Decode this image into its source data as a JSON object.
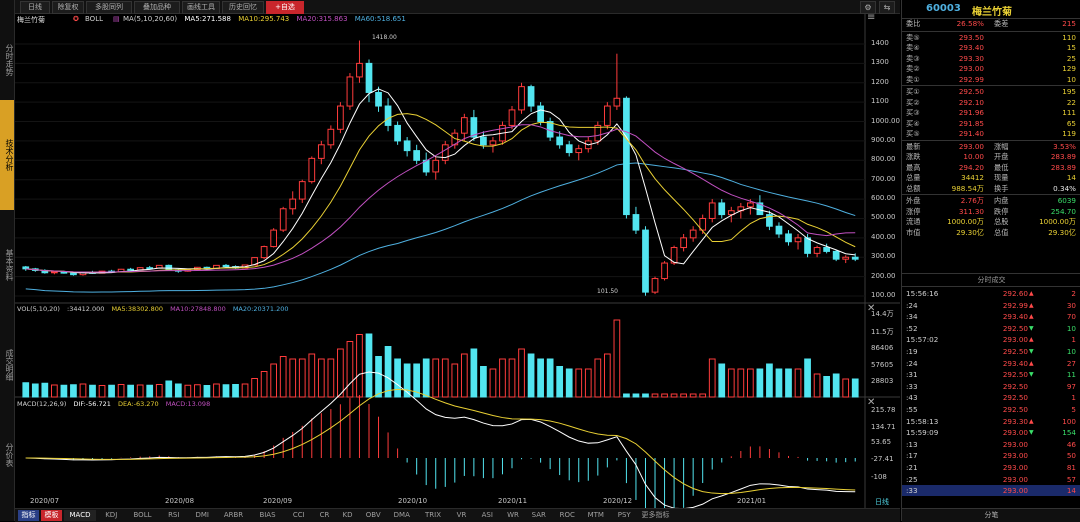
{
  "toolbar": {
    "buttons": [
      {
        "label": "日线"
      },
      {
        "label": "除复权"
      },
      {
        "label": "多股同列"
      },
      {
        "label": "叠加品种"
      },
      {
        "label": "画线工具"
      },
      {
        "label": "历史回忆"
      },
      {
        "label": "+自选",
        "accent": "#c8262c"
      }
    ],
    "small_icons": [
      "gear-icon",
      "back-icon"
    ]
  },
  "left_tabs": [
    {
      "label": "分时走势",
      "active": false
    },
    {
      "label": "技术分析",
      "active": true
    },
    {
      "label": "基本资料",
      "active": false
    },
    {
      "label": "成交明细",
      "active": false
    },
    {
      "label": "分价表",
      "active": false
    }
  ],
  "stock": {
    "name": "梅兰竹菊",
    "code": "60003"
  },
  "main_chart": {
    "indicator_label": "BOLL",
    "ma_labels": [
      {
        "text": "MA(5,10,20,60)",
        "color": "#d0d0d0"
      },
      {
        "text": "MA5:271.588",
        "color": "#ffffff"
      },
      {
        "text": "MA10:295.743",
        "color": "#e9d034"
      },
      {
        "text": "MA20:315.863",
        "color": "#c050c0"
      },
      {
        "text": "MA60:518.651",
        "color": "#4fb0e0"
      }
    ],
    "high_label": "1418.00",
    "low_label": "101.50",
    "y_ticks": [
      "1400",
      "1300",
      "1200",
      "1100",
      "1000.00",
      "900.00",
      "800.00",
      "700.00",
      "600.00",
      "500.00",
      "400.00",
      "300.00",
      "200.00",
      "100.00"
    ]
  },
  "vol_chart": {
    "labels": [
      {
        "text": "VOL(5,10,20)",
        "color": "#d0d0d0"
      },
      {
        "text": ":34412.000",
        "color": "#d0d0d0"
      },
      {
        "text": "MA5:38302.800",
        "color": "#e9d034"
      },
      {
        "text": "MA10:27848.800",
        "color": "#c050c0"
      },
      {
        "text": "MA20:20371.200",
        "color": "#4fb0e0"
      }
    ],
    "y_ticks": [
      "14.4万",
      "11.5万",
      "86406",
      "57605",
      "28803"
    ]
  },
  "macd_chart": {
    "labels": [
      {
        "text": "MACD(12,26,9)",
        "color": "#d0d0d0"
      },
      {
        "text": "DIF:-56.721",
        "color": "#ffffff"
      },
      {
        "text": "DEA:-63.270",
        "color": "#e9d034"
      },
      {
        "text": "MACD:13.098",
        "color": "#c050c0"
      }
    ],
    "y_ticks": [
      "215.78",
      "134.71",
      "53.65",
      "-27.41",
      "-108"
    ]
  },
  "x_axis": {
    "labels": [
      "2020/07",
      "2020/08",
      "2020/09",
      "2020/10",
      "2020/11",
      "2020/12",
      "2021/01"
    ],
    "period": "日线"
  },
  "bottom_tabs": [
    {
      "label": "指标",
      "style": "blue"
    },
    {
      "label": "模板",
      "style": "red"
    },
    {
      "label": "MACD",
      "style": "sel"
    },
    {
      "label": "KDJ"
    },
    {
      "label": "BOLL"
    },
    {
      "label": "RSI"
    },
    {
      "label": "DMI"
    },
    {
      "label": "ARBR"
    },
    {
      "label": "BIAS"
    },
    {
      "label": "CCI"
    },
    {
      "label": "CR"
    },
    {
      "label": "KD"
    },
    {
      "label": "OBV"
    },
    {
      "label": "DMA"
    },
    {
      "label": "TRIX"
    },
    {
      "label": "VR"
    },
    {
      "label": "ASI"
    },
    {
      "label": "WR"
    },
    {
      "label": "SAR"
    },
    {
      "label": "ROC"
    },
    {
      "label": "MTM"
    },
    {
      "label": "PSY"
    },
    {
      "label": "更多指标"
    }
  ],
  "quote": {
    "weibi_label": "委比",
    "weibi": "26.58%",
    "weicha_label": "委差",
    "weicha": "215",
    "asks": [
      {
        "label": "卖⑤",
        "price": "293.50",
        "vol": "110"
      },
      {
        "label": "卖④",
        "price": "293.40",
        "vol": "15"
      },
      {
        "label": "卖③",
        "price": "293.30",
        "vol": "25"
      },
      {
        "label": "卖②",
        "price": "293.00",
        "vol": "129"
      },
      {
        "label": "卖①",
        "price": "292.99",
        "vol": "10"
      }
    ],
    "bids": [
      {
        "label": "买①",
        "price": "292.50",
        "vol": "195"
      },
      {
        "label": "买②",
        "price": "292.10",
        "vol": "22"
      },
      {
        "label": "买③",
        "price": "291.96",
        "vol": "111"
      },
      {
        "label": "买④",
        "price": "291.85",
        "vol": "65"
      },
      {
        "label": "买⑤",
        "price": "291.40",
        "vol": "119"
      }
    ],
    "stats": [
      {
        "l1": "最新",
        "v1": "293.00",
        "c1": "red",
        "l2": "涨幅",
        "v2": "3.53%",
        "c2": "red"
      },
      {
        "l1": "涨跌",
        "v1": "10.00",
        "c1": "red",
        "l2": "开盘",
        "v2": "283.89",
        "c2": "red"
      },
      {
        "l1": "最高",
        "v1": "294.20",
        "c1": "red",
        "l2": "最低",
        "v2": "283.89",
        "c2": "red"
      },
      {
        "l1": "总量",
        "v1": "34412",
        "c1": "yellow",
        "l2": "现量",
        "v2": "14",
        "c2": "yellow"
      },
      {
        "l1": "总额",
        "v1": "988.54万",
        "c1": "yellow",
        "l2": "换手",
        "v2": "0.34%",
        "c2": "white"
      },
      {
        "l1": "外盘",
        "v1": "2.76万",
        "c1": "red",
        "l2": "内盘",
        "v2": "6039",
        "c2": "green"
      },
      {
        "l1": "涨停",
        "v1": "311.30",
        "c1": "red",
        "l2": "跌停",
        "v2": "254.70",
        "c2": "green"
      },
      {
        "l1": "流通",
        "v1": "1000.00万",
        "c1": "yellow",
        "l2": "总股",
        "v2": "1000.00万",
        "c2": "yellow"
      },
      {
        "l1": "市值",
        "v1": "29.30亿",
        "c1": "yellow",
        "l2": "总值",
        "v2": "29.30亿",
        "c2": "yellow"
      }
    ]
  },
  "ticks_title": "分时成交",
  "ticks": [
    {
      "t": "15:56:16",
      "p": "292.60",
      "d": "up",
      "v": "2"
    },
    {
      "t": ":24",
      "p": "292.99",
      "d": "up",
      "v": "30"
    },
    {
      "t": ":34",
      "p": "293.40",
      "d": "up",
      "v": "70"
    },
    {
      "t": ":52",
      "p": "292.50",
      "d": "down",
      "v": "10"
    },
    {
      "t": "15:57:02",
      "p": "293.00",
      "d": "up",
      "v": "1"
    },
    {
      "t": ":19",
      "p": "292.50",
      "d": "down",
      "v": "10"
    },
    {
      "t": ":24",
      "p": "293.40",
      "d": "up",
      "v": "27"
    },
    {
      "t": ":31",
      "p": "292.50",
      "d": "down",
      "v": "11"
    },
    {
      "t": ":33",
      "p": "292.50",
      "d": "",
      "v": "97"
    },
    {
      "t": ":43",
      "p": "292.50",
      "d": "",
      "v": "1"
    },
    {
      "t": ":55",
      "p": "292.50",
      "d": "",
      "v": "5"
    },
    {
      "t": "15:58:13",
      "p": "293.30",
      "d": "up",
      "v": "100"
    },
    {
      "t": "15:59:09",
      "p": "293.00",
      "d": "down",
      "v": "154"
    },
    {
      "t": ":13",
      "p": "293.00",
      "d": "",
      "v": "46"
    },
    {
      "t": ":17",
      "p": "293.00",
      "d": "",
      "v": "50"
    },
    {
      "t": ":21",
      "p": "293.00",
      "d": "",
      "v": "81"
    },
    {
      "t": ":25",
      "p": "293.00",
      "d": "",
      "v": "57"
    },
    {
      "t": ":33",
      "p": "293.00",
      "d": "",
      "v": "14"
    }
  ],
  "footer_tab": "分笔",
  "chart_data": {
    "type": "candlestick",
    "ylim": [
      100,
      1418
    ],
    "candles": [
      [
        250,
        255,
        230,
        240
      ],
      [
        240,
        245,
        225,
        232
      ],
      [
        232,
        238,
        215,
        220
      ],
      [
        220,
        228,
        212,
        225
      ],
      [
        225,
        230,
        215,
        218
      ],
      [
        218,
        222,
        205,
        210
      ],
      [
        210,
        225,
        205,
        222
      ],
      [
        222,
        230,
        215,
        218
      ],
      [
        218,
        230,
        216,
        228
      ],
      [
        228,
        235,
        220,
        224
      ],
      [
        224,
        240,
        222,
        238
      ],
      [
        238,
        245,
        230,
        235
      ],
      [
        235,
        248,
        232,
        246
      ],
      [
        246,
        255,
        240,
        244
      ],
      [
        244,
        260,
        242,
        258
      ],
      [
        258,
        262,
        230,
        235
      ],
      [
        235,
        240,
        220,
        228
      ],
      [
        228,
        240,
        225,
        236
      ],
      [
        236,
        250,
        233,
        248
      ],
      [
        248,
        252,
        238,
        242
      ],
      [
        242,
        260,
        240,
        258
      ],
      [
        258,
        265,
        248,
        252
      ],
      [
        252,
        258,
        240,
        244
      ],
      [
        244,
        262,
        242,
        260
      ],
      [
        260,
        300,
        258,
        298
      ],
      [
        298,
        360,
        290,
        355
      ],
      [
        355,
        450,
        350,
        440
      ],
      [
        440,
        560,
        430,
        550
      ],
      [
        550,
        640,
        520,
        600
      ],
      [
        600,
        700,
        580,
        690
      ],
      [
        690,
        820,
        680,
        810
      ],
      [
        810,
        900,
        780,
        880
      ],
      [
        880,
        980,
        860,
        960
      ],
      [
        960,
        1100,
        940,
        1080
      ],
      [
        1080,
        1250,
        1060,
        1230
      ],
      [
        1230,
        1418,
        1200,
        1300
      ],
      [
        1300,
        1320,
        1100,
        1150
      ],
      [
        1150,
        1180,
        1050,
        1080
      ],
      [
        1080,
        1120,
        950,
        980
      ],
      [
        980,
        1000,
        880,
        900
      ],
      [
        900,
        920,
        820,
        850
      ],
      [
        850,
        880,
        780,
        800
      ],
      [
        800,
        840,
        720,
        740
      ],
      [
        740,
        820,
        700,
        800
      ],
      [
        800,
        900,
        780,
        880
      ],
      [
        880,
        960,
        860,
        940
      ],
      [
        940,
        1040,
        900,
        1020
      ],
      [
        1020,
        1060,
        900,
        920
      ],
      [
        920,
        950,
        860,
        880
      ],
      [
        880,
        920,
        840,
        900
      ],
      [
        900,
        1000,
        880,
        980
      ],
      [
        980,
        1080,
        960,
        1060
      ],
      [
        1060,
        1200,
        1040,
        1180
      ],
      [
        1180,
        1190,
        1050,
        1080
      ],
      [
        1080,
        1100,
        980,
        1000
      ],
      [
        1000,
        1020,
        900,
        920
      ],
      [
        920,
        950,
        860,
        880
      ],
      [
        880,
        900,
        820,
        840
      ],
      [
        840,
        880,
        800,
        860
      ],
      [
        860,
        920,
        840,
        900
      ],
      [
        900,
        1000,
        880,
        980
      ],
      [
        980,
        1100,
        960,
        1080
      ],
      [
        1080,
        1350,
        1060,
        1120
      ],
      [
        1120,
        1130,
        500,
        520
      ],
      [
        520,
        560,
        420,
        440
      ],
      [
        440,
        460,
        101.5,
        120
      ],
      [
        120,
        200,
        110,
        190
      ],
      [
        190,
        280,
        180,
        270
      ],
      [
        270,
        360,
        260,
        350
      ],
      [
        350,
        420,
        330,
        400
      ],
      [
        400,
        460,
        380,
        440
      ],
      [
        440,
        520,
        420,
        500
      ],
      [
        500,
        600,
        480,
        580
      ],
      [
        580,
        600,
        500,
        520
      ],
      [
        520,
        560,
        480,
        540
      ],
      [
        540,
        580,
        500,
        560
      ],
      [
        560,
        600,
        520,
        580
      ],
      [
        580,
        620,
        540,
        520
      ],
      [
        520,
        540,
        440,
        460
      ],
      [
        460,
        480,
        400,
        420
      ],
      [
        420,
        440,
        360,
        380
      ],
      [
        380,
        420,
        340,
        400
      ],
      [
        400,
        420,
        300,
        320
      ],
      [
        320,
        360,
        300,
        350
      ],
      [
        350,
        370,
        320,
        330
      ],
      [
        330,
        340,
        280,
        290
      ],
      [
        290,
        310,
        270,
        300
      ],
      [
        300,
        320,
        280,
        290
      ]
    ]
  }
}
